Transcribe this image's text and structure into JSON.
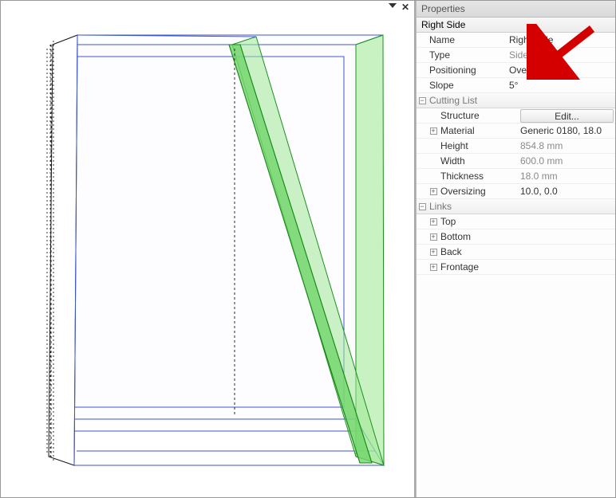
{
  "viewport": {
    "dropdown_glyph": "▾",
    "close_glyph": "✕"
  },
  "panel": {
    "title": "Properties",
    "selection": "Right Side",
    "rows": {
      "name": {
        "label": "Name",
        "value": "Right Side"
      },
      "type": {
        "label": "Type",
        "value": "Side"
      },
      "positioning": {
        "label": "Positioning",
        "value": "Overall"
      },
      "slope": {
        "label": "Slope",
        "value": "5°"
      }
    },
    "cutting_list": {
      "header": "Cutting List",
      "structure": {
        "label": "Structure",
        "button": "Edit..."
      },
      "material": {
        "label": "Material",
        "value": "Generic 0180, 18.0"
      },
      "height": {
        "label": "Height",
        "value": "854.8 mm"
      },
      "width": {
        "label": "Width",
        "value": "600.0 mm"
      },
      "thickness": {
        "label": "Thickness",
        "value": "18.0 mm"
      },
      "oversizing": {
        "label": "Oversizing",
        "value": "10.0, 0.0"
      }
    },
    "links": {
      "header": "Links",
      "top": "Top",
      "bottom": "Bottom",
      "back": "Back",
      "frontage": "Frontage"
    }
  }
}
